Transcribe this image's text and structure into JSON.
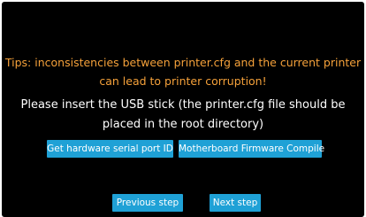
{
  "screen": {
    "tips_line1": "Tips: inconsistencies between printer.cfg and the current printer",
    "tips_line2": "can lead to printer corruption!",
    "instruction_line1": "Please insert the USB stick (the printer.cfg file should be",
    "instruction_line2": "placed in the root directory)"
  },
  "buttons": {
    "serial_port": "Get hardware serial port ID",
    "firmware_compile": "Motherboard Firmware Compile",
    "previous": "Previous step",
    "next": "Next step"
  },
  "colors": {
    "background": "#000000",
    "tips": "#f5a13a",
    "button": "#1fa1d6",
    "text": "#ffffff"
  }
}
